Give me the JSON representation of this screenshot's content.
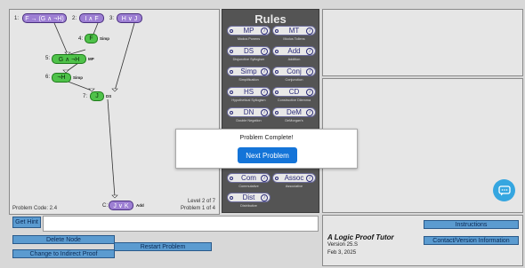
{
  "canvas": {
    "premises": [
      {
        "num": "1:",
        "text": "F → (G ∧ ¬H)"
      },
      {
        "num": "2:",
        "text": "I ∧ F"
      },
      {
        "num": "3:",
        "text": "H ∨ J"
      }
    ],
    "derived": [
      {
        "num": "4:",
        "text": "F",
        "rule": "Simp"
      },
      {
        "num": "5:",
        "text": "G ∧ ¬H",
        "rule": "MP"
      },
      {
        "num": "6:",
        "text": "¬H",
        "rule": "Simp"
      },
      {
        "num": "7:",
        "text": "J",
        "rule": "DS"
      }
    ],
    "goal": {
      "num": "C:",
      "text": "J ∨ K",
      "rule": "Add"
    },
    "problem_code": "Problem Code: 2.4",
    "level": "Level 2 of 7",
    "problem": "Problem 1 of 4"
  },
  "rules": {
    "title": "Rules",
    "items": [
      {
        "abbr": "MP",
        "name": "Modus Ponens"
      },
      {
        "abbr": "MT",
        "name": "Modus Tollens"
      },
      {
        "abbr": "DS",
        "name": "Disjunctive Syllogism"
      },
      {
        "abbr": "Add",
        "name": "Addition"
      },
      {
        "abbr": "Simp",
        "name": "Simplification"
      },
      {
        "abbr": "Conj",
        "name": "Conjunction"
      },
      {
        "abbr": "HS",
        "name": "Hypothetical Syllogism"
      },
      {
        "abbr": "CD",
        "name": "Constructive Dilemma"
      },
      {
        "abbr": "DN",
        "name": "Double Negation"
      },
      {
        "abbr": "DeM",
        "name": "DeMorgan's"
      },
      {
        "abbr": "Com",
        "name": "Commutative"
      },
      {
        "abbr": "Assoc",
        "name": "Associative"
      },
      {
        "abbr": "Dist",
        "name": "Distributive"
      }
    ],
    "info_glyph": "i"
  },
  "controls": {
    "get_hint": "Get Hint",
    "delete_node": "Delete Node",
    "change_indirect": "Change to Indirect Proof",
    "restart": "Restart Problem"
  },
  "modal": {
    "title": "Problem Complete!",
    "next": "Next Problem"
  },
  "about": {
    "title": "A Logic Proof Tutor",
    "version": "Version 25.S",
    "date": "Feb 3, 2025",
    "instructions": "Instructions",
    "contact": "Contact/Version Information"
  },
  "colors": {
    "premise": "#9d7fd3",
    "derived": "#4fc24a",
    "rules_bg": "#545454",
    "button": "#5b9bd0",
    "primary": "#1474d8",
    "chat": "#35a6e0"
  }
}
